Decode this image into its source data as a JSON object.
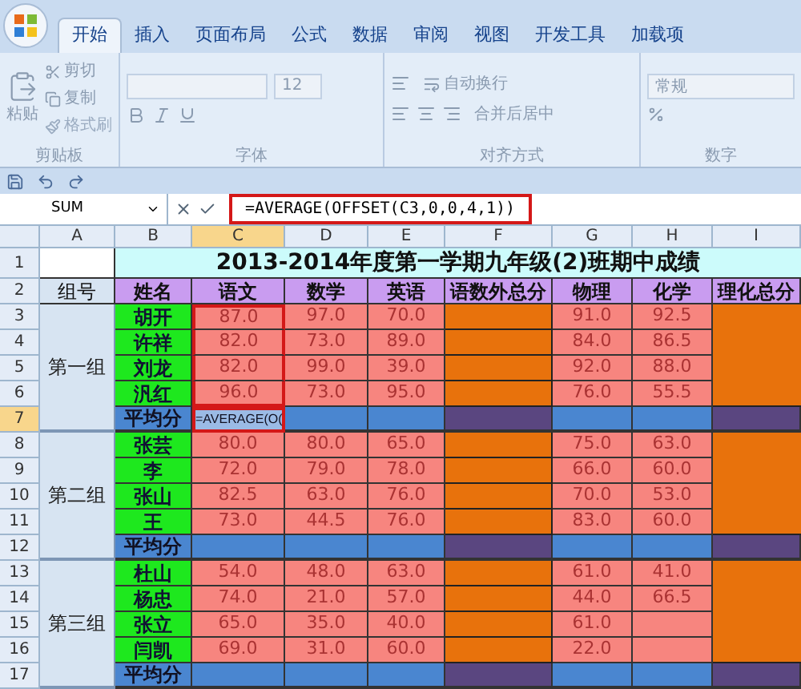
{
  "tabs": [
    {
      "label": "开始",
      "selected": true
    },
    {
      "label": "插入",
      "selected": false
    },
    {
      "label": "页面布局",
      "selected": false
    },
    {
      "label": "公式",
      "selected": false
    },
    {
      "label": "数据",
      "selected": false
    },
    {
      "label": "审阅",
      "selected": false
    },
    {
      "label": "视图",
      "selected": false
    },
    {
      "label": "开发工具",
      "selected": false
    },
    {
      "label": "加载项",
      "selected": false
    }
  ],
  "ribbon": {
    "disabled": true,
    "clipboard": {
      "title": "剪贴板",
      "paste": "粘贴",
      "cut": "剪切",
      "copy": "复制",
      "format_painter": "格式刷"
    },
    "font": {
      "title": "字体",
      "size": "12"
    },
    "alignment": {
      "title": "对齐方式",
      "wrap": "自动换行",
      "merge": "合并后居中"
    },
    "number": {
      "title": "数字",
      "format": "常规"
    }
  },
  "name_box": "SUM",
  "formula": {
    "value": "=AVERAGE(OFFSET(C3,0,0,4,1))",
    "marked": true
  },
  "columns": [
    {
      "label": "A",
      "selected": false
    },
    {
      "label": "B",
      "selected": false
    },
    {
      "label": "C",
      "selected": true
    },
    {
      "label": "D",
      "selected": false
    },
    {
      "label": "E",
      "selected": false
    },
    {
      "label": "F",
      "selected": false
    },
    {
      "label": "G",
      "selected": false
    },
    {
      "label": "H",
      "selected": false
    },
    {
      "label": "I",
      "selected": false
    }
  ],
  "title": "2013-2014年度第一学期九年级(2)班期中成绩",
  "headers": [
    "组号",
    "姓名",
    "语文",
    "数学",
    "英语",
    "语数外总分",
    "物理",
    "化学",
    "理化总分"
  ],
  "groups": [
    {
      "label": "第一组",
      "students": [
        {
          "row": "3",
          "name": "胡开",
          "scores": [
            "87.0",
            "97.0",
            "70.0",
            "91.0",
            "92.5"
          ],
          "marked": true
        },
        {
          "row": "4",
          "name": "许祥",
          "scores": [
            "82.0",
            "73.0",
            "89.0",
            "84.0",
            "86.5"
          ],
          "marked": true
        },
        {
          "row": "5",
          "name": "刘龙",
          "scores": [
            "82.0",
            "99.0",
            "39.0",
            "92.0",
            "88.0"
          ],
          "marked": true
        },
        {
          "row": "6",
          "name": "汎红",
          "scores": [
            "96.0",
            "73.0",
            "95.0",
            "76.0",
            "55.5"
          ],
          "marked": true
        }
      ],
      "average": {
        "row": "7",
        "label": "平均分",
        "row_selected": true,
        "editing": "=AVERAGE(O("
      }
    },
    {
      "label": "第二组",
      "students": [
        {
          "row": "8",
          "name": "张芸",
          "scores": [
            "80.0",
            "80.0",
            "65.0",
            "75.0",
            "63.0"
          ],
          "marked": false
        },
        {
          "row": "9",
          "name": "李",
          "scores": [
            "72.0",
            "79.0",
            "78.0",
            "66.0",
            "60.0"
          ],
          "marked": false
        },
        {
          "row": "10",
          "name": "张山",
          "scores": [
            "82.5",
            "63.0",
            "76.0",
            "70.0",
            "53.0"
          ],
          "marked": false
        },
        {
          "row": "11",
          "name": "王",
          "scores": [
            "73.0",
            "44.5",
            "76.0",
            "83.0",
            "60.0"
          ],
          "marked": false
        }
      ],
      "average": {
        "row": "12",
        "label": "平均分",
        "row_selected": false
      }
    },
    {
      "label": "第三组",
      "students": [
        {
          "row": "13",
          "name": "杜山",
          "scores": [
            "54.0",
            "48.0",
            "63.0",
            "61.0",
            "41.0"
          ],
          "marked": false
        },
        {
          "row": "14",
          "name": "杨忠",
          "scores": [
            "74.0",
            "21.0",
            "57.0",
            "44.0",
            "66.5"
          ],
          "marked": false
        },
        {
          "row": "15",
          "name": "张立",
          "scores": [
            "65.0",
            "35.0",
            "40.0",
            "61.0"
          ],
          "marked": false
        },
        {
          "row": "16",
          "name": "闫凯",
          "scores": [
            "69.0",
            "31.0",
            "60.0",
            "22.0"
          ],
          "marked": false
        }
      ],
      "average": {
        "row": "17",
        "label": "平均分",
        "row_selected": false
      }
    }
  ],
  "title_row": "1",
  "header_row": "2"
}
